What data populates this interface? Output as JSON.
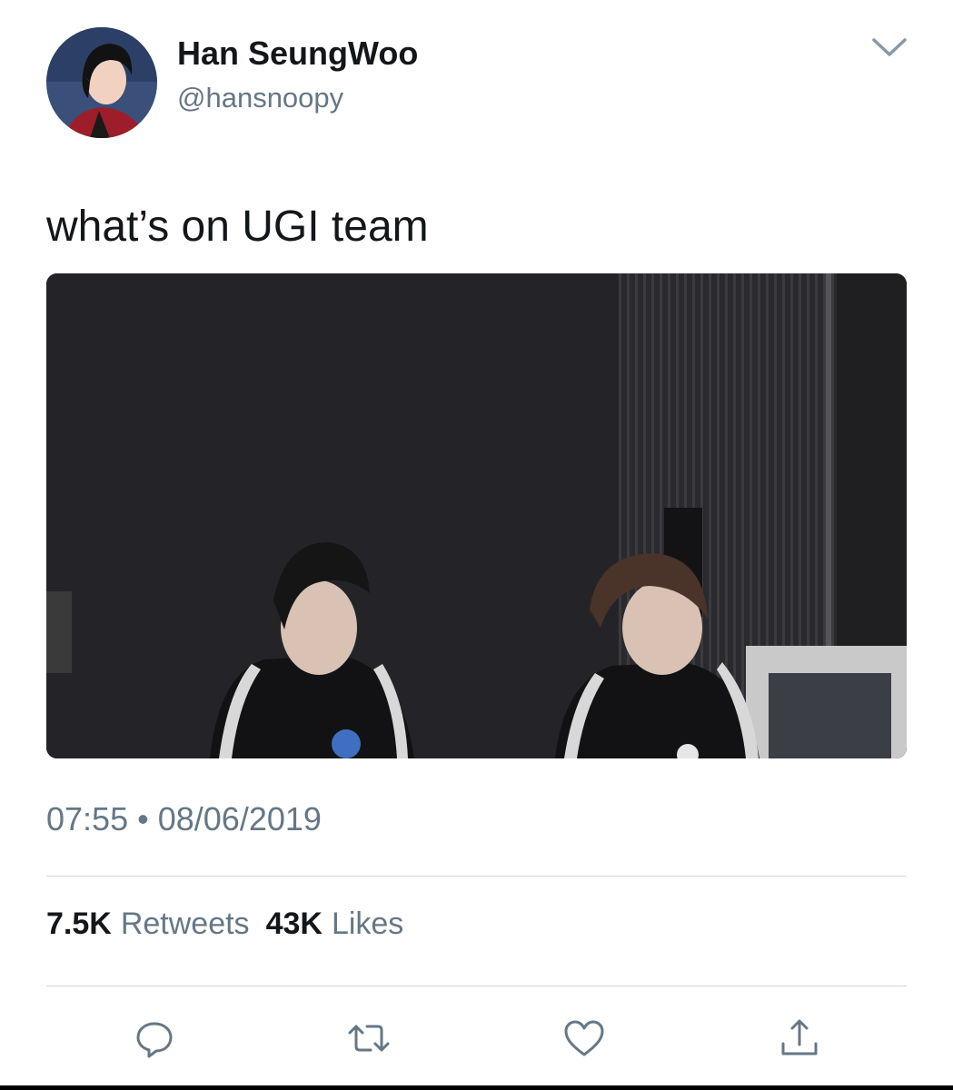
{
  "tweet": {
    "author": {
      "display_name": "Han SeungWoo",
      "handle": "@hansnoopy"
    },
    "text": "what’s on UGI team",
    "time": "07:55",
    "separator": "•",
    "date": "08/06/2019",
    "stats": {
      "retweets_count": "7.5K",
      "retweets_label": "Retweets",
      "likes_count": "43K",
      "likes_label": "Likes"
    }
  },
  "icons": {
    "menu": "chevron-down-icon",
    "reply": "reply-icon",
    "retweet": "retweet-icon",
    "like": "heart-icon",
    "share": "share-icon"
  },
  "colors": {
    "primary_text": "#14171a",
    "secondary_text": "#657786",
    "divider": "#cfd5da",
    "icon": "#657786"
  }
}
